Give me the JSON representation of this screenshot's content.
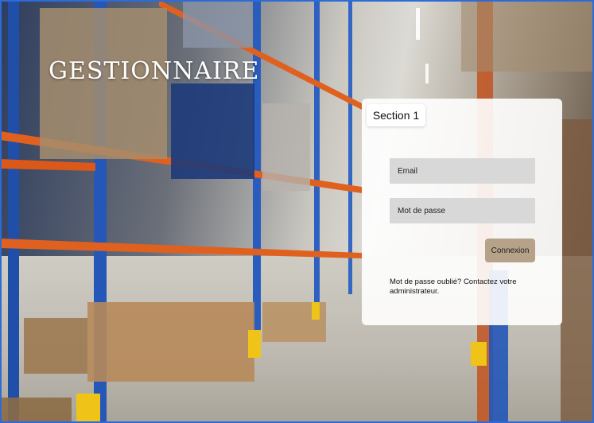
{
  "app": {
    "title": "GESTIONNAIRE"
  },
  "panel": {
    "section_label": "Section 1",
    "email_placeholder": "Email",
    "password_placeholder": "Mot de passe",
    "login_label": "Connexion",
    "forgot_text": "Mot de passe oublié? Contactez votre administrateur."
  },
  "colors": {
    "frame_border": "#2f6bd6",
    "login_button": "#b5a289",
    "input_background": "#d8d8d8",
    "panel_background": "#ffffff"
  }
}
